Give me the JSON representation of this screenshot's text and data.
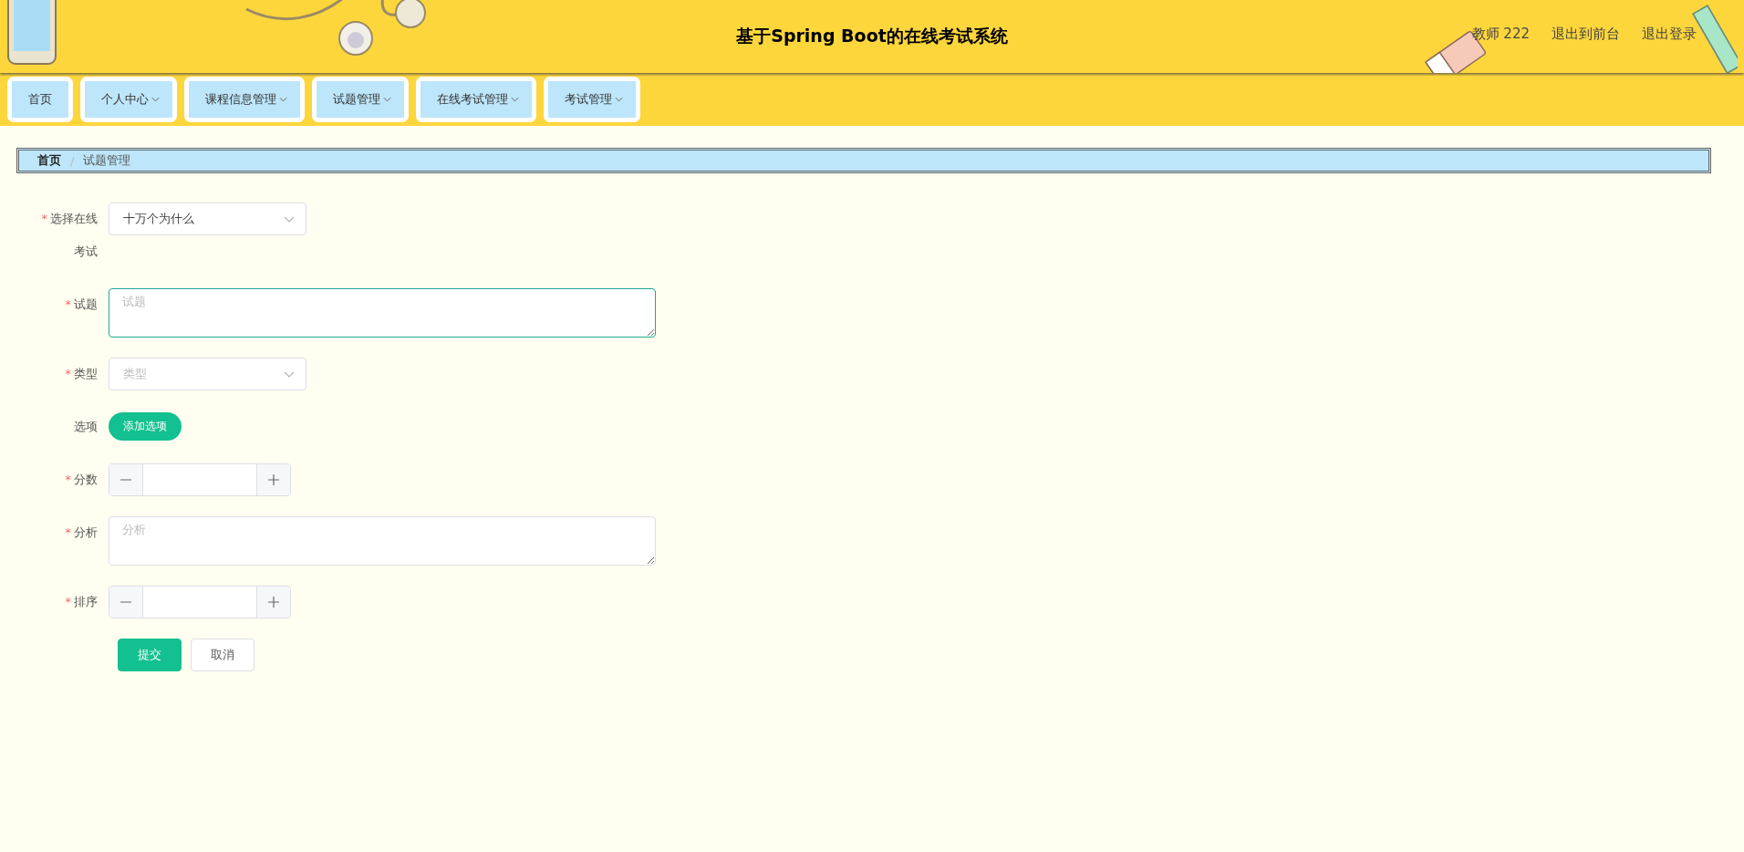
{
  "header": {
    "title": "基于Spring Boot的在线考试系统",
    "links": [
      "教师 222",
      "退出到前台",
      "退出登录"
    ]
  },
  "nav": [
    {
      "label": "首页",
      "dropdown": false
    },
    {
      "label": "个人中心",
      "dropdown": true
    },
    {
      "label": "课程信息管理",
      "dropdown": true
    },
    {
      "label": "试题管理",
      "dropdown": true
    },
    {
      "label": "在线考试管理",
      "dropdown": true
    },
    {
      "label": "考试管理",
      "dropdown": true
    }
  ],
  "breadcrumb_separator": "/",
  "breadcrumb": [
    {
      "label": "首页",
      "current": false
    },
    {
      "label": "试题管理",
      "current": true
    }
  ],
  "form": {
    "required_mark": "*",
    "fields": [
      {
        "kind": "select",
        "label": "选择在线考试",
        "required": true,
        "value": "十万个为什么"
      },
      {
        "kind": "textarea",
        "label": "试题",
        "required": true,
        "placeholder": "试题",
        "focused": true
      },
      {
        "kind": "select",
        "label": "类型",
        "required": true,
        "placeholder": "类型"
      },
      {
        "kind": "button",
        "label": "选项",
        "required": false,
        "button": "添加选项"
      },
      {
        "kind": "number",
        "label": "分数",
        "required": true
      },
      {
        "kind": "textarea",
        "label": "分析",
        "required": true,
        "placeholder": "分析",
        "focused": false
      },
      {
        "kind": "number",
        "label": "排序",
        "required": true
      }
    ],
    "actions": [
      "提交",
      "取消"
    ]
  }
}
